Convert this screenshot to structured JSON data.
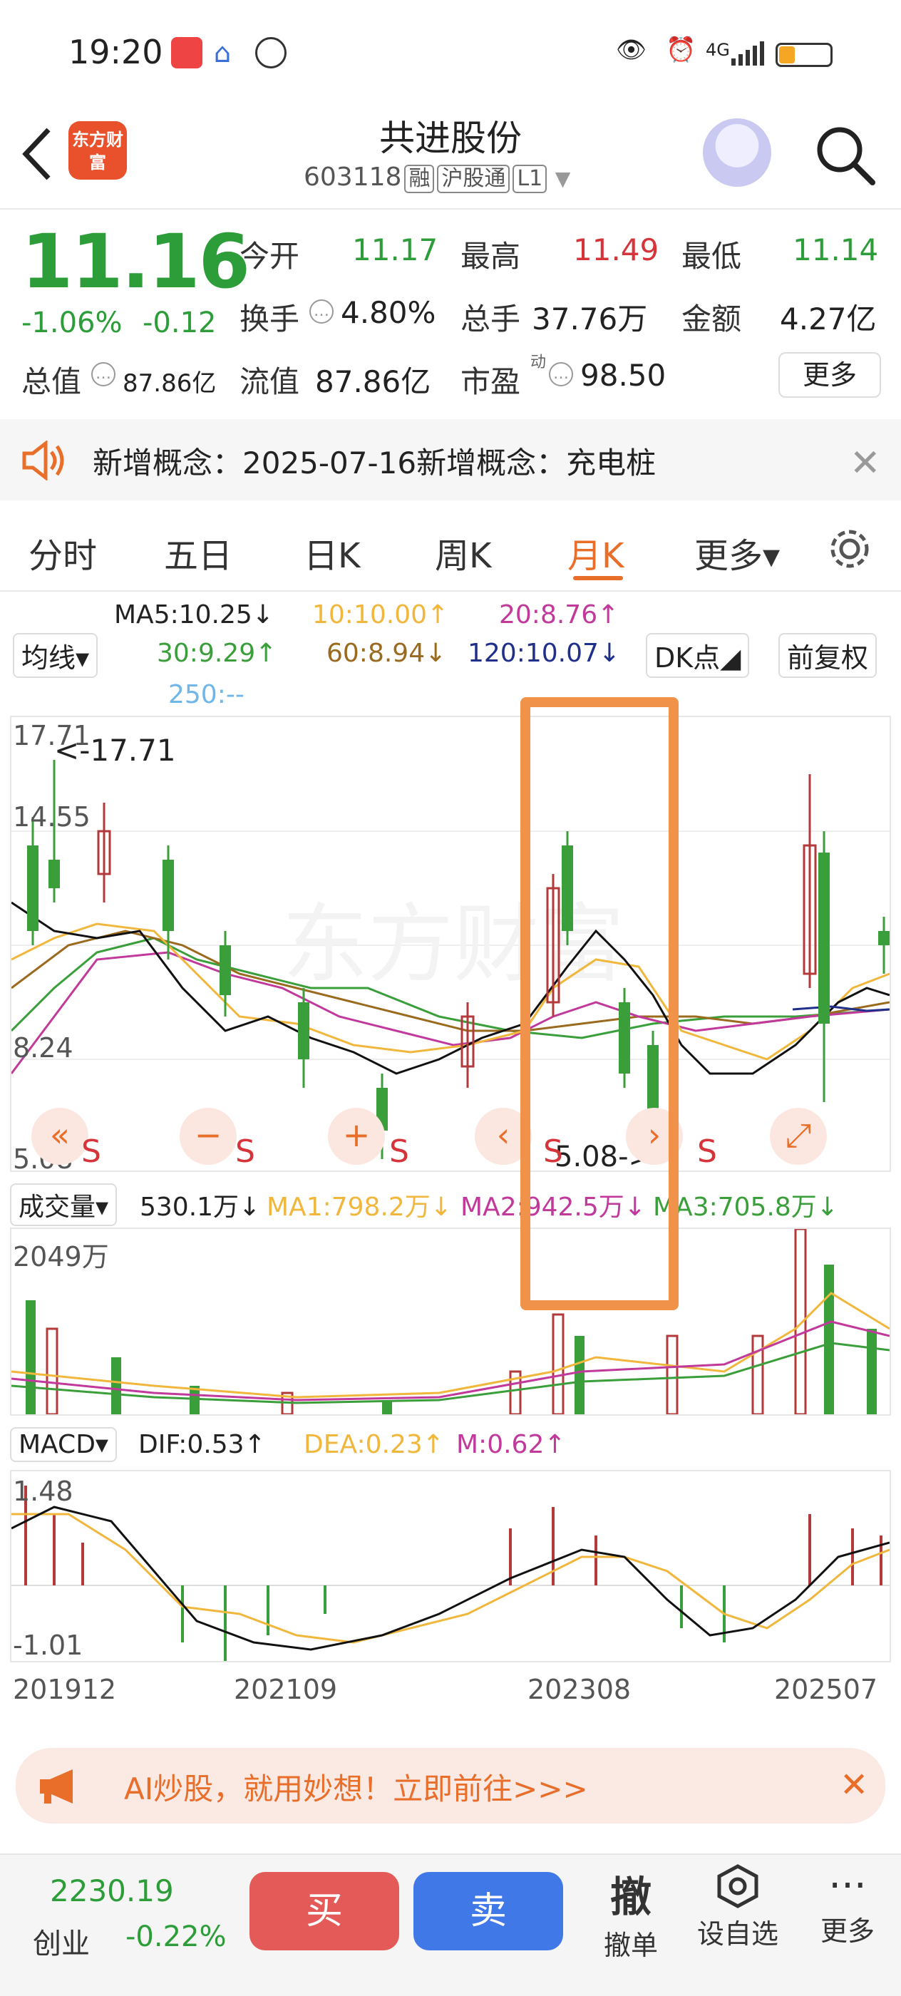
{
  "status": {
    "time": "19:20",
    "network": "4G"
  },
  "header": {
    "logo_text": "东方财富",
    "name": "共进股份",
    "code": "603118",
    "tags": [
      "融",
      "沪股通",
      "L1"
    ]
  },
  "quote": {
    "price": "11.16",
    "change_pct": "-1.06%",
    "change_abs": "-0.12",
    "open_label": "今开",
    "open": "11.17",
    "high_label": "最高",
    "high": "11.49",
    "low_label": "最低",
    "low": "11.14",
    "turnover_label": "换手",
    "turnover": "4.80%",
    "volume_label": "总手",
    "volume": "37.76万",
    "amount_label": "金额",
    "amount": "4.27亿",
    "total_mv_label": "总值",
    "total_mv": "87.86亿",
    "float_mv_label": "流值",
    "float_mv": "87.86亿",
    "pe_label": "市盈",
    "pe_sup": "动",
    "pe": "98.50",
    "more": "更多"
  },
  "notice": {
    "text": "新增概念：2025-07-16新增概念：充电桩"
  },
  "tabs": [
    {
      "label": "分时"
    },
    {
      "label": "五日"
    },
    {
      "label": "日K"
    },
    {
      "label": "周K"
    },
    {
      "label": "月K"
    },
    {
      "label": "更多▾"
    }
  ],
  "ma": {
    "selector": "均线▾",
    "ma5": "MA5:10.25↓",
    "ma10": "10:10.00↑",
    "ma20": "20:8.76↑",
    "ma30": "30:9.29↑",
    "ma60": "60:8.94↓",
    "ma120": "120:10.07↓",
    "ma250": "250:--",
    "dk": "DK点◢",
    "adjust": "前复权"
  },
  "chart": {
    "y_top": "17.71",
    "y_2": "14.55",
    "y_3": "8.24",
    "y_bottom": "5.08",
    "max_label": "<-17.71",
    "min_label": "5.08->",
    "s_mark": "S"
  },
  "volume": {
    "selector": "成交量▾",
    "current": "530.1万↓",
    "ma1": "MA1:798.2万↓",
    "ma2": "MA2:942.5万↓",
    "ma3": "MA3:705.8万↓",
    "max": "2049万"
  },
  "macd": {
    "selector": "MACD▾",
    "dif": "DIF:0.53↑",
    "dea": "DEA:0.23↑",
    "m": "M:0.62↑",
    "top": "1.48",
    "bottom": "-1.01"
  },
  "x_axis": [
    "201912",
    "202109",
    "202308",
    "202507"
  ],
  "ad": {
    "text": "AI炒股，就用妙想！立即前往>>>"
  },
  "bottom": {
    "index_value": "2230.19",
    "index_name": "创业",
    "index_change": "-0.22%",
    "buy": "买",
    "sell": "卖",
    "cancel_icon": "撤",
    "cancel": "撤单",
    "watch": "设自选",
    "more": "更多"
  }
}
